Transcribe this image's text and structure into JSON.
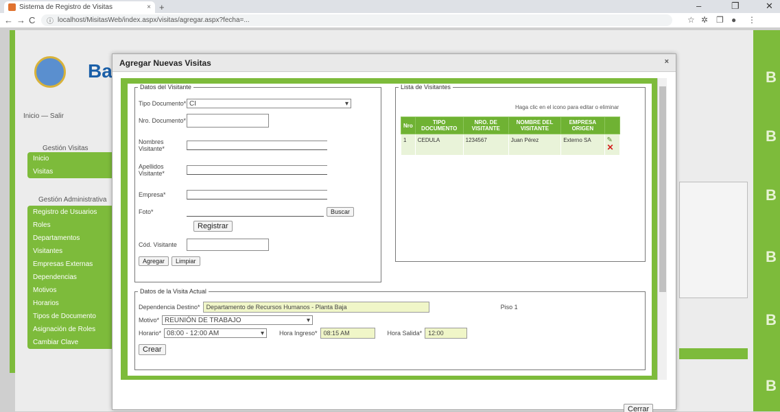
{
  "browser": {
    "tab_title": "Sistema de Registro de Visitas",
    "url": "localhost/MisitasWeb/index.aspx/visitas/agregar.aspx?fecha=...",
    "new_tab": "+",
    "reload": "C",
    "back": "←",
    "forward": "→",
    "close_tab": "×",
    "min": "–",
    "max": "❐",
    "win_close": "✕"
  },
  "background": {
    "logo_text": "Ba",
    "header_link": "Inicio  —  Salir",
    "section1_title": "Gestión Visitas",
    "section1_items": [
      "Inicio",
      "Visitas"
    ],
    "section2_title": "Gestión Administrativa",
    "section2_items": [
      "Registro de Usuarios",
      "Roles",
      "Departamentos",
      "Visitantes",
      "Empresas Externas",
      "Dependencias",
      "Motivos",
      "Horarios",
      "Tipos de Documento",
      "Asignación de Roles",
      "Cambiar Clave"
    ],
    "right_letters": [
      "B",
      "B",
      "B",
      "B",
      "B",
      "B"
    ]
  },
  "dialog": {
    "title": "Agregar Nuevas Visitas",
    "close": "×",
    "cerrar": "Cerrar"
  },
  "visitante_form": {
    "legend": "Datos del Visitante",
    "tipo_doc_label": "Tipo Documento*",
    "tipo_doc_value": "CI",
    "num_doc_label": "Nro. Documento*",
    "nombres_label": "Nombres Visitante*",
    "apellidos_label": "Apellidos Visitante*",
    "empresa_label": "Empresa*",
    "foto_label": "Foto*",
    "buscar_button": "Buscar",
    "registrar_button": "Registrar",
    "cod_label": "Cód. Visitante",
    "agregar_button": "Agregar",
    "limpiar_button": "Limpiar"
  },
  "lista_visitantes": {
    "legend": "Lista de Visitantes",
    "hint": "Haga clic en el icono para editar o eliminar",
    "headers": [
      "Nro",
      "TIPO DOCUMENTO",
      "NRO. DE VISITANTE",
      "NOMBRE DEL VISITANTE",
      "EMPRESA ORIGEN"
    ],
    "rows": [
      {
        "nro": "1",
        "tipo": "CEDULA",
        "num": "1234567",
        "nombre": "Juan Pérez",
        "empresa": "Externo SA"
      }
    ]
  },
  "visita_form": {
    "legend": "Datos de la Visita Actual",
    "depto_label": "Dependencia Destino*",
    "depto_value": "Departamento de Recursos Humanos - Planta Baja",
    "depto_extra": "Piso 1",
    "motivo_label": "Motivo*",
    "motivo_value": "REUNIÓN DE TRABAJO",
    "horario_label": "Horario*",
    "horario_value": "08:00 - 12:00 AM",
    "hora_ingreso_label": "Hora Ingreso*",
    "hora_ingreso_value": "08:15 AM",
    "hora_salida_label": "Hora Salida*",
    "hora_salida_value": "12:00",
    "crear_button": "Crear"
  }
}
